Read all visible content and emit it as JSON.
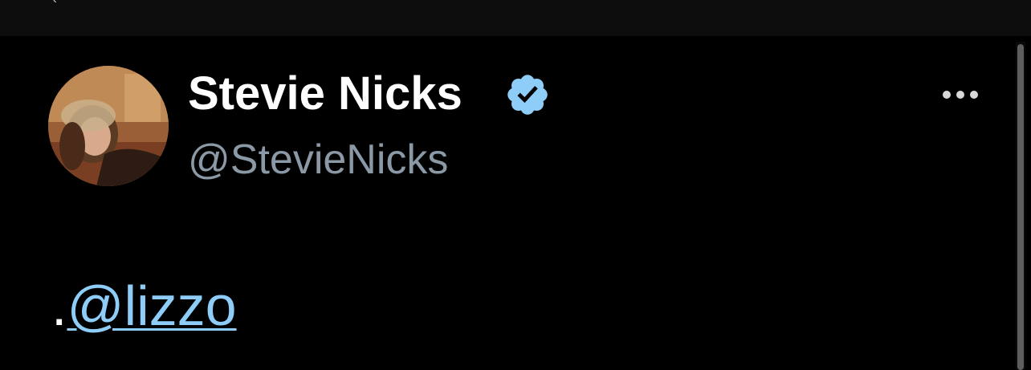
{
  "top_bar": {
    "glyph": "‹"
  },
  "profile": {
    "display_name": "Stevie Nicks",
    "handle": "@StevieNicks",
    "verified": true,
    "verified_color": "#8ecdf8",
    "avatar_icon": "profile-photo"
  },
  "menu": {
    "icon": "more-horizontal-icon"
  },
  "tweet": {
    "prefix": ".",
    "mention": "@lizzo",
    "mention_color": "#8ecdf8"
  },
  "colors": {
    "background": "#000000",
    "top_bar": "#0d0d0d",
    "name": "#ffffff",
    "handle": "#8b98a5",
    "scrollbar": "#5e5e5e"
  }
}
